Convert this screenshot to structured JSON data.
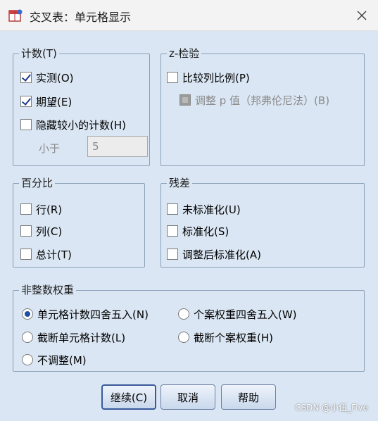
{
  "window": {
    "title": "交叉表：单元格显示"
  },
  "counts": {
    "title": "计数(T)",
    "observed": "实测(O)",
    "expected": "期望(E)",
    "hide_small": "隐藏较小的计数(H)",
    "less_than_label": "小于",
    "less_than_value": "5"
  },
  "ztest": {
    "title": "z-检验",
    "compare": "比较列比例(P)",
    "adjust": "调整 p 值（邦弗伦尼法）(B)"
  },
  "percentages": {
    "title": "百分比",
    "row": "行(R)",
    "column": "列(C)",
    "total": "总计(T)"
  },
  "residuals": {
    "title": "残差",
    "unstandardized": "未标准化(U)",
    "standardized": "标准化(S)",
    "adjusted": "调整后标准化(A)"
  },
  "noninteger": {
    "title": "非整数权重",
    "round_cell": "单元格计数四舍五入(N)",
    "round_case": "个案权重四舍五入(W)",
    "truncate_cell": "截断单元格计数(L)",
    "truncate_case": "截断个案权重(H)",
    "no_adjust": "不调整(M)"
  },
  "buttons": {
    "continue": "继续(C)",
    "cancel": "取消",
    "help": "帮助"
  },
  "watermark": "CSDN @小伍_Five",
  "colors": {
    "client_bg": "#dae6f3",
    "group_border": "#8aa0b8",
    "check_accent": "#1e3a8c"
  }
}
